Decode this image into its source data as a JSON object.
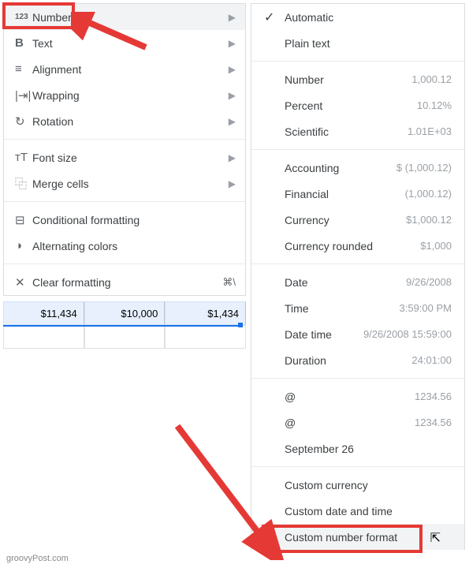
{
  "menu_left": {
    "items": [
      {
        "icon": "123",
        "label": "Number",
        "arrow": true,
        "hl": true
      },
      {
        "icon": "B",
        "label": "Text",
        "arrow": true
      },
      {
        "icon": "≡",
        "label": "Alignment",
        "arrow": true
      },
      {
        "icon": "|⇥|",
        "label": "Wrapping",
        "arrow": true
      },
      {
        "icon": "↻",
        "label": "Rotation",
        "arrow": true
      }
    ],
    "items2": [
      {
        "icon": "ᴛT",
        "label": "Font size",
        "arrow": true
      },
      {
        "icon": "⿻",
        "label": "Merge cells",
        "arrow": true
      }
    ],
    "items3": [
      {
        "icon": "⊟",
        "label": "Conditional formatting"
      },
      {
        "icon": "◑",
        "label": "Alternating colors"
      }
    ],
    "items4": [
      {
        "icon": "✕",
        "label": "Clear formatting",
        "shortcut": "⌘\\"
      }
    ]
  },
  "menu_right": {
    "group1": [
      {
        "check": "✓",
        "label": "Automatic"
      },
      {
        "label": "Plain text"
      }
    ],
    "group2": [
      {
        "label": "Number",
        "value": "1,000.12"
      },
      {
        "label": "Percent",
        "value": "10.12%"
      },
      {
        "label": "Scientific",
        "value": "1.01E+03"
      }
    ],
    "group3": [
      {
        "label": "Accounting",
        "value": "$ (1,000.12)"
      },
      {
        "label": "Financial",
        "value": "(1,000.12)"
      },
      {
        "label": "Currency",
        "value": "$1,000.12"
      },
      {
        "label": "Currency rounded",
        "value": "$1,000"
      }
    ],
    "group4": [
      {
        "label": "Date",
        "value": "9/26/2008"
      },
      {
        "label": "Time",
        "value": "3:59:00 PM"
      },
      {
        "label": "Date time",
        "value": "9/26/2008 15:59:00"
      },
      {
        "label": "Duration",
        "value": "24:01:00"
      }
    ],
    "group5": [
      {
        "label": "@",
        "value": "1234.56"
      },
      {
        "label": "@",
        "value": "1234.56"
      },
      {
        "label": "September 26"
      }
    ],
    "group6": [
      {
        "label": "Custom currency"
      },
      {
        "label": "Custom date and time"
      },
      {
        "label": "Custom number format",
        "hl": true
      }
    ]
  },
  "sheet": {
    "cells": [
      "$11,434",
      "$10,000",
      "$1,434"
    ]
  },
  "watermark": "groovyPost.com"
}
